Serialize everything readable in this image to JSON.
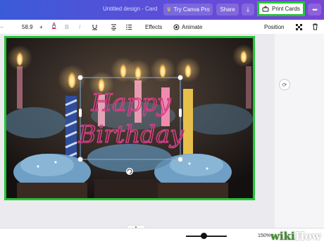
{
  "header": {
    "doc_title": "Untitled design - Card",
    "try_pro": "Try Canva Pro",
    "share": "Share",
    "print": "Print Cards",
    "more": "•••"
  },
  "toolbar": {
    "font_size": "58.9",
    "minus": "−",
    "plus": "+",
    "color_letter": "A",
    "bold": "B",
    "italic": "I",
    "effects": "Effects",
    "animate": "Animate",
    "position": "Position"
  },
  "canvas": {
    "text_line1": "Happy",
    "text_line2": "Birthday"
  },
  "status": {
    "zoom": "150%",
    "watermark_wiki": "wiki",
    "watermark_how": "How"
  },
  "colors": {
    "header_gradient": [
      "#3a5bd9",
      "#7a45d6"
    ],
    "highlight": "#22c535",
    "text_color": "#c62e7a"
  },
  "icons": {
    "crown": "crown-icon",
    "download": "download-icon",
    "print": "print-icon",
    "transparency": "checkerboard-icon",
    "delete": "trash-icon",
    "rotate": "rotate-icon",
    "move": "move-icon",
    "refresh": "refresh-icon"
  }
}
